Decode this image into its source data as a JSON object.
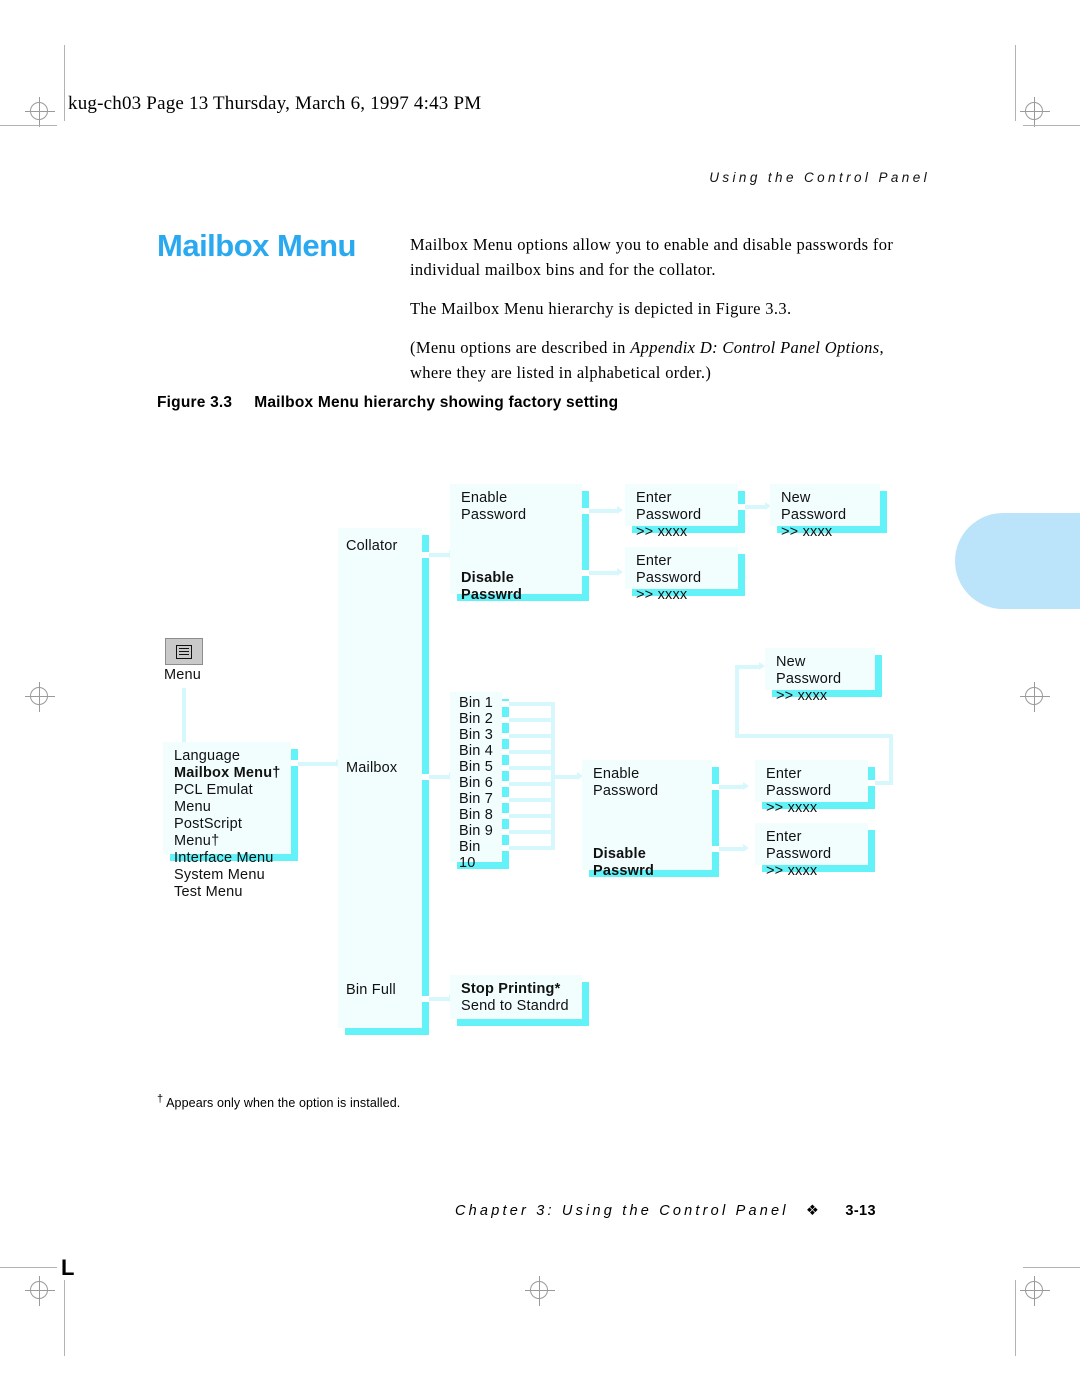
{
  "page": {
    "filestamp": "kug-ch03  Page 13  Thursday, March 6, 1997  4:43 PM",
    "running_head": "Using the Control Panel",
    "title": "Mailbox Menu",
    "body": [
      "Mailbox Menu options allow you to enable and disable passwords for individual mailbox bins and for the collator.",
      "The Mailbox Menu hierarchy is depicted in Figure 3.3.",
      "(Menu options are described in Appendix D: Control Panel Options, where they are listed in alphabetical order.)"
    ],
    "body_italic_part": "Appendix D: Control Panel Options",
    "figure_label": "Figure 3.3",
    "figure_caption": "Mailbox Menu hierarchy showing factory setting",
    "footnote": "Appears only when the option is installed.",
    "footnote_marker": "†",
    "footer_chapter": "Chapter 3: Using the Control Panel",
    "footer_diamond": "❖",
    "footer_page": "3-13",
    "crop_mark_glyph": "L",
    "colors": {
      "accent_title": "#2aa9f0",
      "node_fill": "#f2fdfe",
      "node_shadow": "#62f2f8",
      "connector": "#d6f7fb",
      "tab": "#bbe4fa",
      "button": "#c9c9c9"
    }
  },
  "diagram": {
    "menu_button_label": "Menu",
    "menu_icon": "menu-lines-icon",
    "menu_list": {
      "items": [
        "Language",
        "Mailbox Menu†",
        "PCL Emulat Menu",
        "PostScript Menu†",
        "Interface Menu",
        "System Menu",
        "Test Menu"
      ],
      "bold_index": 1
    },
    "branches": {
      "collator_label": "Collator",
      "mailbox_label": "Mailbox",
      "bin_full_label": "Bin Full"
    },
    "collator_options": {
      "enable": "Enable Password",
      "disable": "Disable Passwrd",
      "disable_is_default": true
    },
    "collator_enable_next": {
      "line1": "Enter Password",
      "line2": ">> xxxx"
    },
    "collator_enable_next2": {
      "line1": "New Password",
      "line2": ">> xxxx"
    },
    "collator_disable_next": {
      "line1": "Enter Password",
      "line2": ">> xxxx"
    },
    "bins": [
      "Bin 1",
      "Bin 2",
      "Bin 3",
      "Bin 4",
      "Bin 5",
      "Bin 6",
      "Bin 7",
      "Bin 8",
      "Bin 9",
      "Bin 10"
    ],
    "mailbox_options": {
      "enable": "Enable Password",
      "disable": "Disable Passwrd",
      "disable_is_default": true
    },
    "mailbox_enable_next": {
      "line1": "Enter Password",
      "line2": ">> xxxx"
    },
    "mailbox_new_password": {
      "line1": "New Password",
      "line2": ">> xxxx"
    },
    "mailbox_disable_next": {
      "line1": "Enter Password",
      "line2": ">> xxxx"
    },
    "bin_full_options": {
      "line1": "Stop Printing*",
      "line2": "Send to Standrd"
    }
  }
}
